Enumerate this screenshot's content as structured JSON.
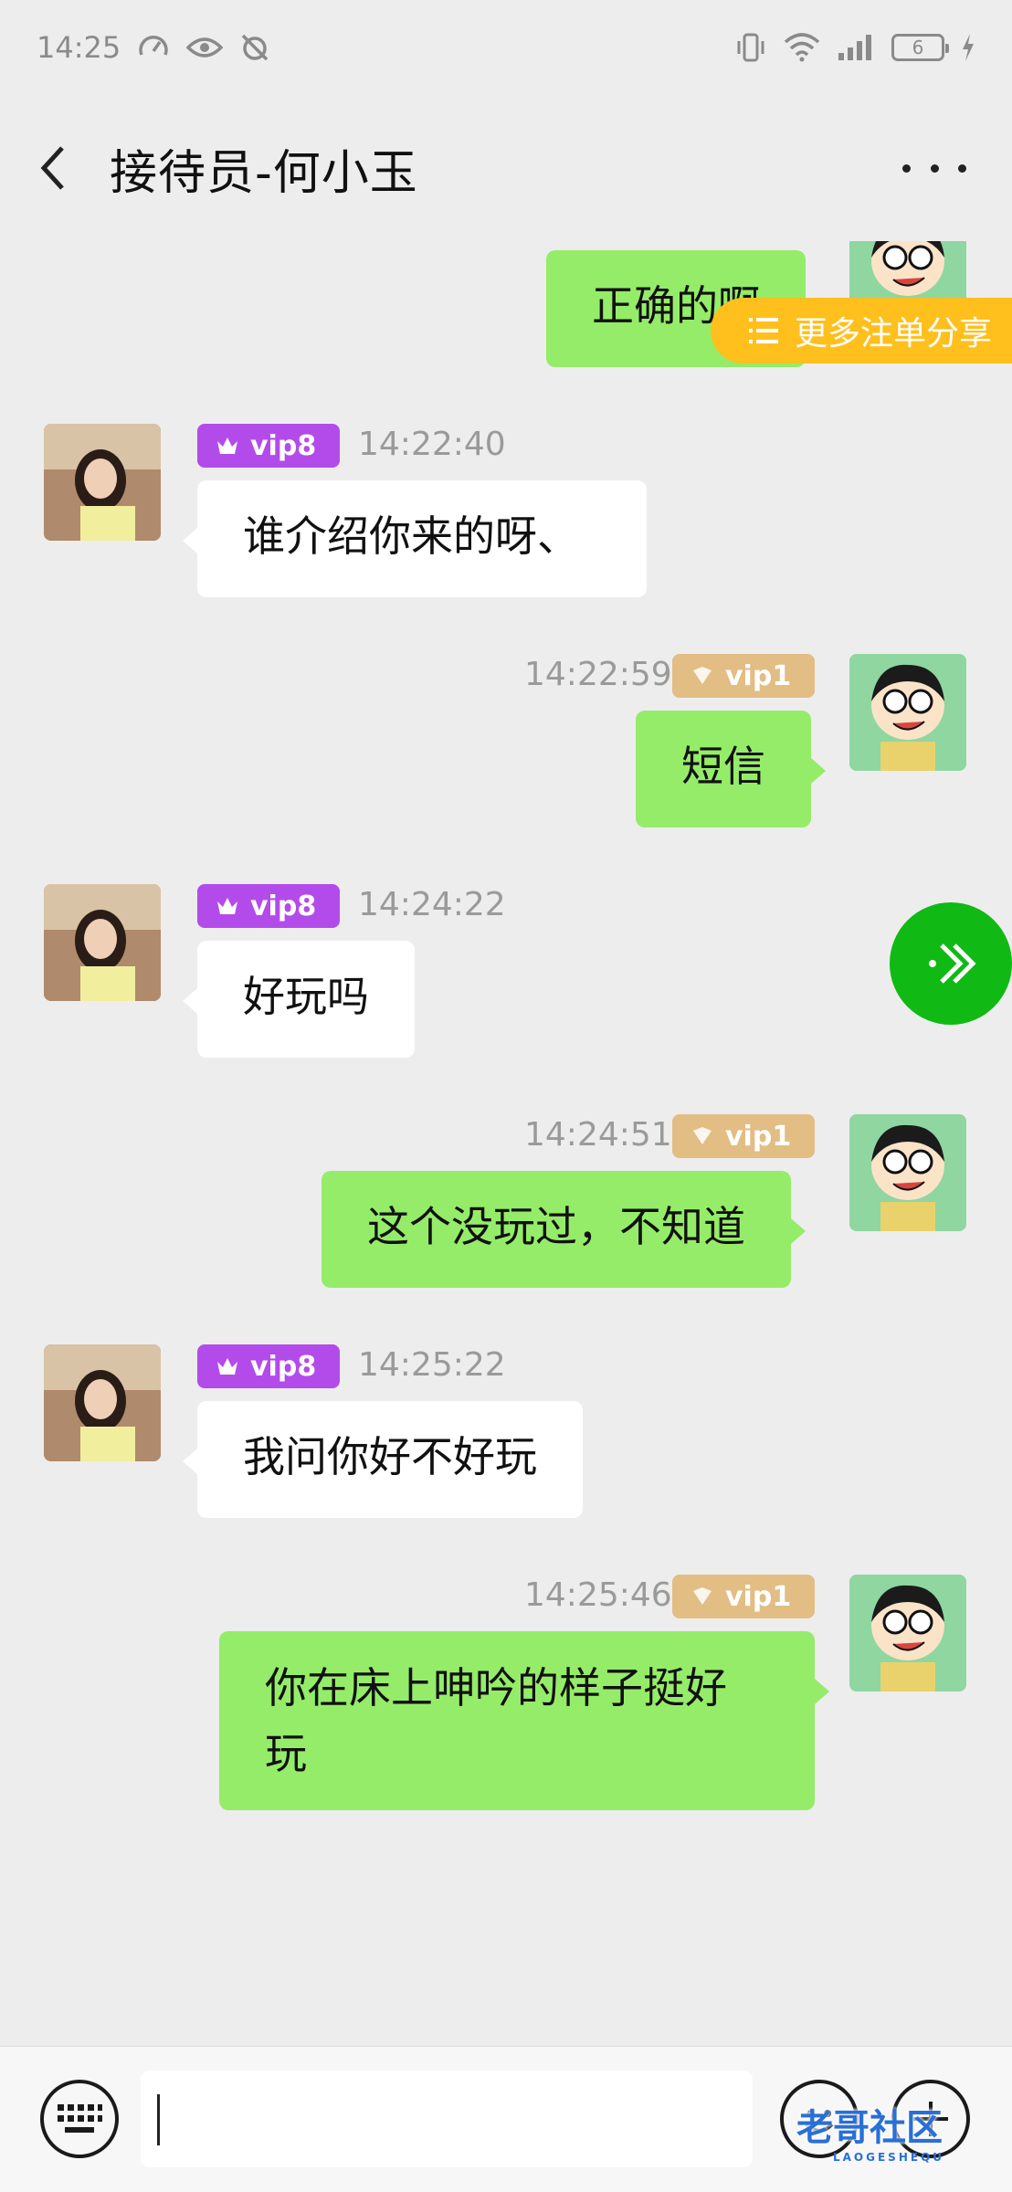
{
  "status_bar": {
    "time": "14:25",
    "battery": "6"
  },
  "header": {
    "title": "接待员-何小玉"
  },
  "share_pill": {
    "label": "更多注单分享"
  },
  "messages": [
    {
      "side": "right",
      "text": "正确的啊",
      "partial": true
    },
    {
      "side": "left",
      "badge": "vip8",
      "time": "14:22:40",
      "text": "谁介绍你来的呀、"
    },
    {
      "side": "right",
      "badge": "vip1",
      "time": "14:22:59",
      "text": "短信"
    },
    {
      "side": "left",
      "badge": "vip8",
      "time": "14:24:22",
      "text": "好玩吗"
    },
    {
      "side": "right",
      "badge": "vip1",
      "time": "14:24:51",
      "text": "这个没玩过，不知道"
    },
    {
      "side": "left",
      "badge": "vip8",
      "time": "14:25:22",
      "text": "我问你好不好玩"
    },
    {
      "side": "right",
      "badge": "vip1",
      "time": "14:25:46",
      "text_line1": "你在床上呻吟的样子挺好",
      "text_line2": "玩"
    }
  ],
  "input": {
    "value": ""
  },
  "watermark": {
    "main": "老哥社区",
    "sub": "LAOGESHEQU"
  },
  "colors": {
    "bubble_self": "#95ec69",
    "bubble_other": "#ffffff",
    "vip8_badge": "#b34bea",
    "vip1_badge": "#e2bd84",
    "share_pill": "#ffbf1d",
    "float_button": "#10b914"
  }
}
